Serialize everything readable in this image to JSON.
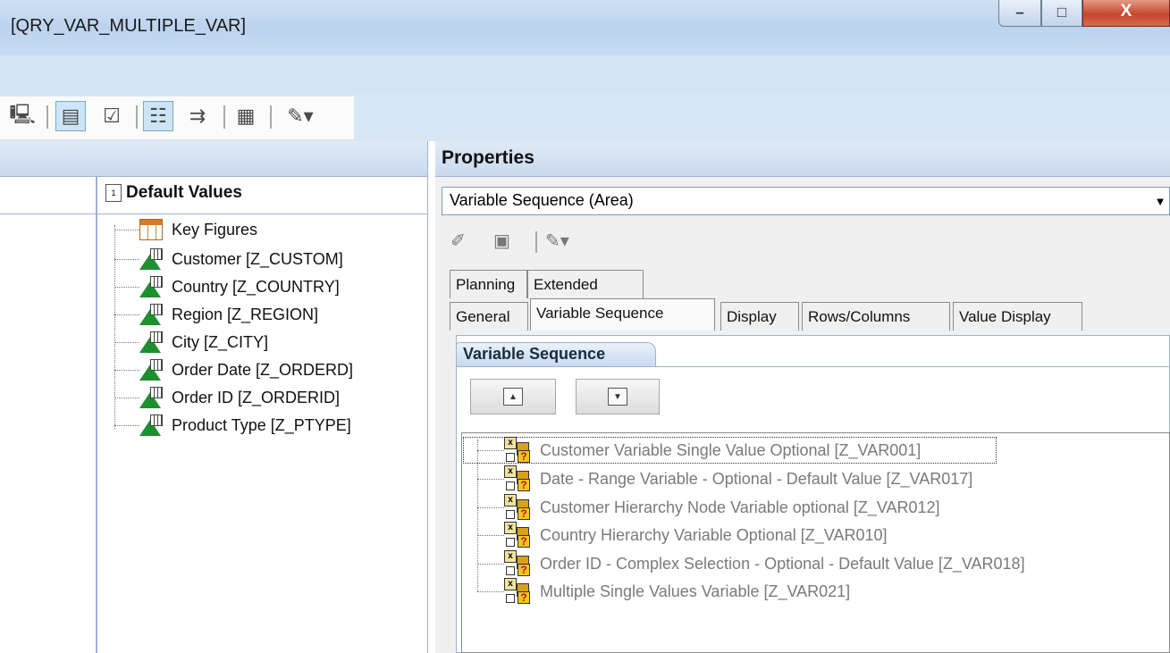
{
  "window": {
    "title": "[QRY_VAR_MULTIPLE_VAR]",
    "controls": {
      "minimize": "–",
      "maximize": "□",
      "close": "X"
    }
  },
  "toolbar": {
    "icons": [
      "computer-icon",
      "list-view-icon",
      "checklist-icon",
      "tree-view-icon",
      "export-icon",
      "properties-icon",
      "tools-icon"
    ]
  },
  "default_values": {
    "title": "Default Values",
    "items": [
      {
        "label": "Key Figures",
        "icon": "key-figures-icon"
      },
      {
        "label": "Customer [Z_CUSTOM]",
        "icon": "characteristic-icon"
      },
      {
        "label": "Country [Z_COUNTRY]",
        "icon": "hierarchy-characteristic-icon"
      },
      {
        "label": "Region [Z_REGION]",
        "icon": "characteristic-icon"
      },
      {
        "label": "City [Z_CITY]",
        "icon": "characteristic-icon"
      },
      {
        "label": "Order Date [Z_ORDERD]",
        "icon": "characteristic-icon"
      },
      {
        "label": "Order ID [Z_ORDERID]",
        "icon": "characteristic-icon"
      },
      {
        "label": "Product Type [Z_PTYPE]",
        "icon": "characteristic-icon"
      }
    ]
  },
  "properties": {
    "title": "Properties",
    "selector_value": "Variable Sequence (Area)",
    "tabs_row1": [
      "Planning",
      "Extended"
    ],
    "tabs_row2": [
      "General",
      "Variable Sequence",
      "Display",
      "Rows/Columns",
      "Value Display"
    ],
    "selected_tab": "Variable Sequence",
    "section_title": "Variable Sequence",
    "variables": [
      "Customer Variable Single Value Optional [Z_VAR001]",
      "Date - Range Variable - Optional - Default Value [Z_VAR017]",
      "Customer Hierarchy Node Variable optional [Z_VAR012]",
      "Country Hierarchy Variable Optional [Z_VAR010]",
      "Order ID - Complex Selection - Optional - Default Value [Z_VAR018]",
      "Multiple Single Values Variable [Z_VAR021]"
    ]
  }
}
